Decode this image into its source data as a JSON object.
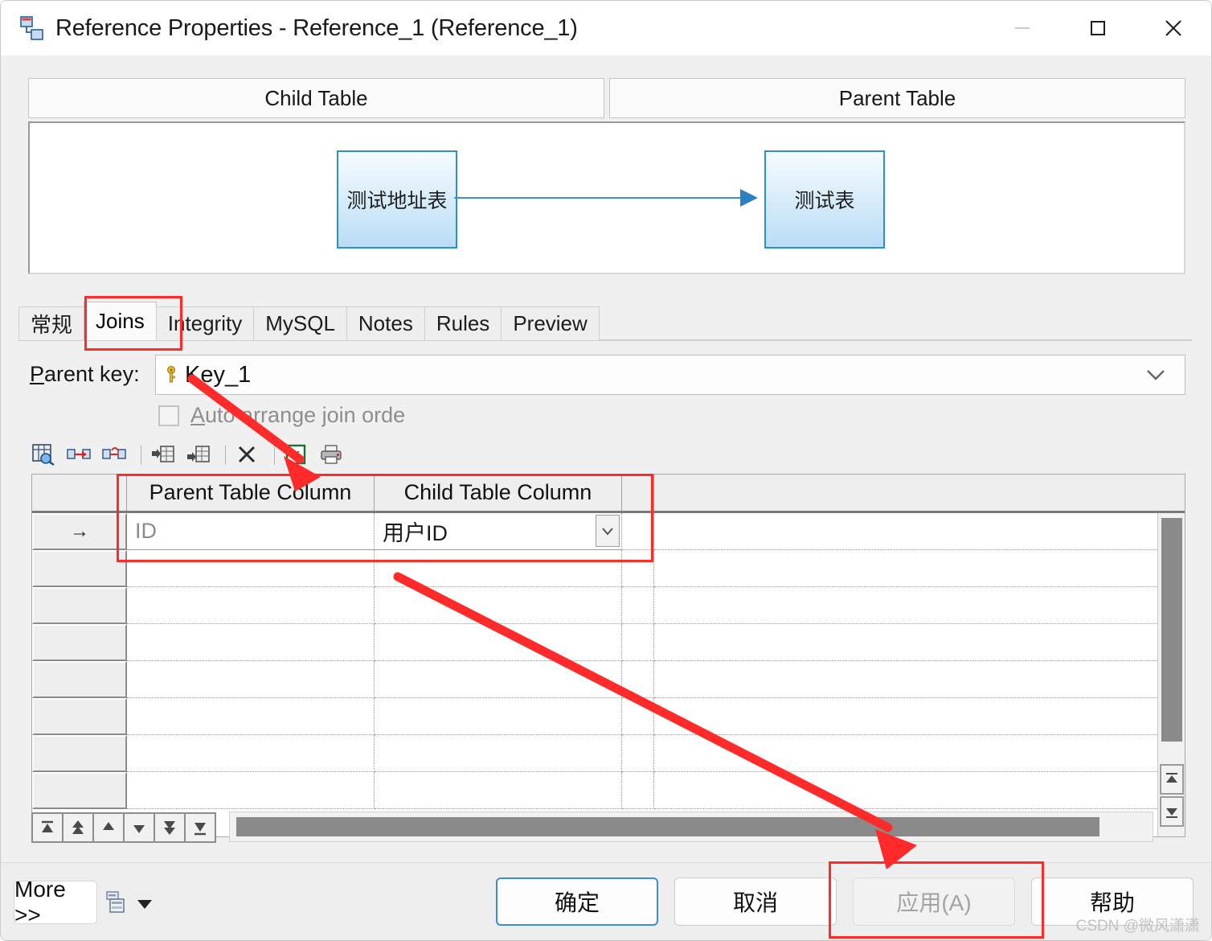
{
  "window": {
    "title": "Reference Properties - Reference_1 (Reference_1)",
    "icon": "reference-properties-icon",
    "controls": {
      "minimize": "minimize-icon",
      "maximize": "maximize-icon",
      "close": "close-icon"
    }
  },
  "panels": {
    "child_header": "Child Table",
    "parent_header": "Parent Table"
  },
  "diagram": {
    "child_entity": "测试地址表",
    "parent_entity": "测试表",
    "relation": "one-to-many-arrow",
    "entity_border_color": "#2b8fd0",
    "entity_fill_top": "#f6fbff",
    "entity_fill_bottom": "#b9ddf6",
    "line_color": "#3f8fcf"
  },
  "tabs": [
    {
      "label": "常规",
      "active": false
    },
    {
      "label": "Joins",
      "active": true
    },
    {
      "label": "Integrity",
      "active": false
    },
    {
      "label": "MySQL",
      "active": false
    },
    {
      "label": "Notes",
      "active": false
    },
    {
      "label": "Rules",
      "active": false
    },
    {
      "label": "Preview",
      "active": false
    }
  ],
  "joins": {
    "parent_key_label": "Parent key:",
    "parent_key_mnemonic": "P",
    "parent_key_value": "Key_1",
    "parent_key_icon": "key-icon",
    "auto_arrange_label": "Auto arrange join orde",
    "auto_arrange_mnemonic": "A",
    "auto_arrange_checked": false,
    "auto_arrange_enabled": false
  },
  "grid_toolbar": [
    {
      "name": "find-columns-icon"
    },
    {
      "name": "link-columns-icon"
    },
    {
      "name": "unlink-columns-icon"
    },
    {
      "name": "insert-row-before-icon"
    },
    {
      "name": "insert-row-after-icon"
    },
    {
      "name": "delete-row-icon"
    },
    {
      "name": "export-excel-icon"
    },
    {
      "name": "print-icon"
    }
  ],
  "grid": {
    "columns": [
      "",
      "Parent Table Column",
      "Child Table Column",
      "",
      ""
    ],
    "rows": [
      {
        "indicator": "→",
        "parent_column": "ID",
        "child_column": "用户ID",
        "has_dropdown": true
      },
      {
        "indicator": "",
        "parent_column": "",
        "child_column": "",
        "has_dropdown": false
      },
      {
        "indicator": "",
        "parent_column": "",
        "child_column": "",
        "has_dropdown": false
      },
      {
        "indicator": "",
        "parent_column": "",
        "child_column": "",
        "has_dropdown": false
      },
      {
        "indicator": "",
        "parent_column": "",
        "child_column": "",
        "has_dropdown": false
      },
      {
        "indicator": "",
        "parent_column": "",
        "child_column": "",
        "has_dropdown": false
      },
      {
        "indicator": "",
        "parent_column": "",
        "child_column": "",
        "has_dropdown": false
      },
      {
        "indicator": "",
        "parent_column": "",
        "child_column": "",
        "has_dropdown": false
      }
    ]
  },
  "record_nav": [
    {
      "name": "nav-first-icon"
    },
    {
      "name": "nav-prev-page-icon"
    },
    {
      "name": "nav-prev-icon"
    },
    {
      "name": "nav-next-icon"
    },
    {
      "name": "nav-next-page-icon"
    },
    {
      "name": "nav-last-icon"
    }
  ],
  "footer": {
    "more_label": "More >>",
    "more_icon": "layout-options-icon",
    "ok_label": "确定",
    "cancel_label": "取消",
    "apply_label": "应用(A)",
    "apply_enabled": false,
    "help_label": "帮助"
  },
  "watermark": "CSDN @微风潇潇",
  "annotations": {
    "highlight_color": "#ff2a2a",
    "boxes": [
      "joins-tab",
      "join-mapping-row",
      "apply-button"
    ],
    "arrows": [
      "parent-key-to-mapping",
      "mapping-to-apply"
    ]
  }
}
